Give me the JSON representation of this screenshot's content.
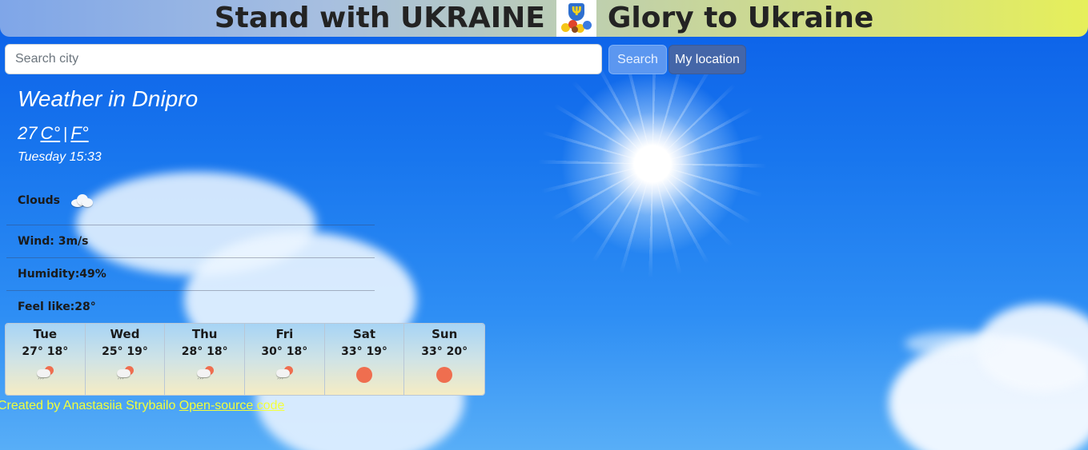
{
  "banner": {
    "left_text": "Stand with UKRAINE",
    "right_text": "Glory to Ukraine",
    "emblem_icon": "ukraine-emblem-with-sunflowers"
  },
  "search": {
    "placeholder": "Search city",
    "value": "",
    "search_label": "Search",
    "location_label": "My location"
  },
  "current": {
    "city_title": "Weather in Dnipro",
    "temperature": "27",
    "unit_c": "C°",
    "unit_separator": "|",
    "unit_f": "F°",
    "datetime": "Tuesday 15:33",
    "condition": "Clouds",
    "condition_icon": "cloud-icon",
    "wind": "Wind: 3m/s",
    "humidity": "Humidity:49%",
    "feels_like": "Feel like:28°"
  },
  "forecast": [
    {
      "day": "Tue",
      "temps": "27° 18°",
      "icon": "rain-sun-icon"
    },
    {
      "day": "Wed",
      "temps": "25° 19°",
      "icon": "rain-sun-icon"
    },
    {
      "day": "Thu",
      "temps": "28° 18°",
      "icon": "rain-sun-icon"
    },
    {
      "day": "Fri",
      "temps": "30° 18°",
      "icon": "rain-sun-icon"
    },
    {
      "day": "Sat",
      "temps": "33° 19°",
      "icon": "sun-icon"
    },
    {
      "day": "Sun",
      "temps": "33° 20°",
      "icon": "sun-icon"
    }
  ],
  "footer": {
    "credit": "Created by Anastasiia Strybailo",
    "link_label": "Open-source code"
  },
  "colors": {
    "footer_text": "#f3ff3a",
    "sun_icon": "#ef6e4f",
    "location_button": "#4466a8",
    "search_button": "#5c97f0"
  }
}
